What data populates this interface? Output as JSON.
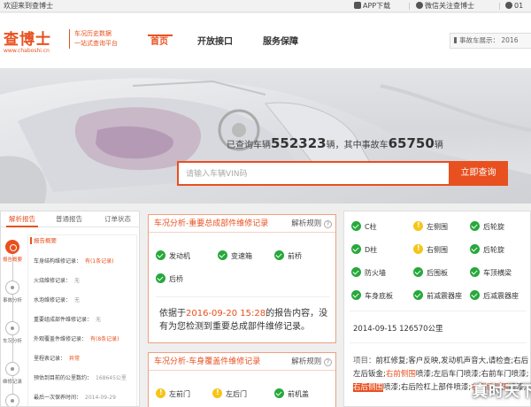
{
  "topbar": {
    "welcome": "欢迎来到查博士",
    "app_download": "APP下载",
    "wechat": "微信关注查博士",
    "cut": "01"
  },
  "header": {
    "logo_text": "查博士",
    "logo_url": "www.chaboshi.cn",
    "slogan_line1": "车况历史数据",
    "slogan_line2": "一站式查询平台",
    "nav": [
      "首页",
      "开放接口",
      "服务保障"
    ],
    "ticker": "事故车展示：   2016"
  },
  "banner": {
    "stats_prefix": "已查询车辆",
    "stats_count": "552323",
    "stats_mid": "辆，其中事故车",
    "accident_count": "65750",
    "stats_suffix": "辆",
    "search_placeholder": "请输入车辆VIN码",
    "search_button": "立即查询"
  },
  "left_panel": {
    "tabs": [
      "解析报告",
      "普通报告",
      "订单状态"
    ],
    "timeline": [
      "报告概要",
      "事故分析",
      "车况分析",
      "维修记录",
      "车况分析"
    ],
    "card_title": "报告概要",
    "rows": [
      {
        "label": "车身结构维修记录：",
        "value": "有(1条记录)",
        "warn": true
      },
      {
        "label": "火烧维修记录：",
        "value": "无",
        "warn": false
      },
      {
        "label": "水泡维修记录：",
        "value": "无",
        "warn": false
      },
      {
        "label": "重要组成部件维修记录：",
        "value": "无",
        "warn": false
      },
      {
        "label": "外观覆盖件维修记录：",
        "value": "有(8条记录)",
        "warn": true
      },
      {
        "label": "里程表记录：",
        "value": "异常",
        "warn": true
      },
      {
        "label": "预估到目前的公里数约：",
        "value": "168645公里",
        "warn": false
      },
      {
        "label": "最后一次保养时间：",
        "value": "2014-09-29",
        "warn": false
      }
    ]
  },
  "card1": {
    "tag": "车况分析",
    "title": "-重要总成部件维修记录",
    "rule": "解析规则",
    "q": "?",
    "items": [
      "发动机",
      "变速箱",
      "前桥",
      "后桥"
    ],
    "text_prefix": "依据于",
    "text_date": "2016-09-20 15:28",
    "text_rest": "的报告内容，没有为您检测到重要总成部件维修记录。"
  },
  "card2": {
    "tag": "车况分析",
    "title": "-车身覆盖件维修记录",
    "rule": "解析规则",
    "q": "?",
    "items": [
      "左前门",
      "左后门",
      "前机盖"
    ]
  },
  "right_panel": {
    "items": [
      {
        "label": "C柱",
        "warn": false
      },
      {
        "label": "左侧围",
        "warn": true
      },
      {
        "label": "后轮旋",
        "warn": false
      },
      {
        "label": "D柱",
        "warn": false
      },
      {
        "label": "右侧围",
        "warn": true
      },
      {
        "label": "后轮旋",
        "warn": false
      },
      {
        "label": "防火墙",
        "warn": false
      },
      {
        "label": "后围板",
        "warn": false
      },
      {
        "label": "车顶横梁",
        "warn": false
      },
      {
        "label": "车身底板",
        "warn": false
      },
      {
        "label": "前减震器座",
        "warn": false
      },
      {
        "label": "后减震器座",
        "warn": false
      }
    ],
    "date_mileage": "2014-09-15  126570公里",
    "project_label": "项目：",
    "project_text_1": "前杠修复;客户反映,发动机声音大,请检查;右后左后钣金;",
    "project_hl_1": "右前侧围",
    "project_text_2": "喷漆;左后车门喷漆;右前车门喷漆;",
    "project_hl_2": "右后侧围",
    "project_text_3": "喷漆;右后险杠上部件喷漆;",
    "project_hl_3": "右侧后侧围",
    "project_text_4": "喷漆;"
  },
  "watermark": "真时天下",
  "colors": {
    "accent": "#e8501f",
    "ok": "#27a83b",
    "warn": "#f5c518"
  }
}
